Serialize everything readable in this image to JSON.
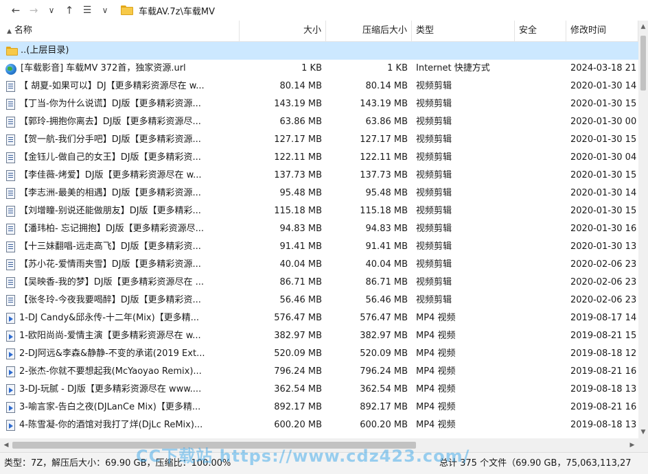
{
  "address_bar": {
    "path": "车载AV.7z\\车载MV"
  },
  "columns": {
    "name": "名称",
    "size": "大小",
    "compressed": "压缩后大小",
    "type": "类型",
    "security": "安全",
    "modified": "修改时间"
  },
  "parent_row": {
    "name": "..(上层目录)"
  },
  "rows": [
    {
      "icon": "globe-icon",
      "name": "[车载影音] 车载MV 372首，独家资源.url",
      "size": "1 KB",
      "compressed": "1 KB",
      "type": "Internet 快捷方式",
      "date": "2024-03-18 21"
    },
    {
      "icon": "video-file-icon",
      "name": "【 胡夏-如果可以】DJ【更多精彩资源尽在 w...",
      "size": "80.14 MB",
      "compressed": "80.14 MB",
      "type": "视频剪辑",
      "date": "2020-01-30 14"
    },
    {
      "icon": "video-file-icon",
      "name": "【丁当-你为什么说谎】DJ版【更多精彩资源...",
      "size": "143.19 MB",
      "compressed": "143.19 MB",
      "type": "视频剪辑",
      "date": "2020-01-30 15"
    },
    {
      "icon": "video-file-icon",
      "name": "【郭玲-拥抱你离去】DJ版【更多精彩资源尽...",
      "size": "63.86 MB",
      "compressed": "63.86 MB",
      "type": "视频剪辑",
      "date": "2020-01-30 00"
    },
    {
      "icon": "video-file-icon",
      "name": "【贺一航-我们分手吧】DJ版【更多精彩资源...",
      "size": "127.17 MB",
      "compressed": "127.17 MB",
      "type": "视频剪辑",
      "date": "2020-01-30 15"
    },
    {
      "icon": "video-file-icon",
      "name": "【金钰儿-做自己的女王】DJ版【更多精彩资...",
      "size": "122.11 MB",
      "compressed": "122.11 MB",
      "type": "视频剪辑",
      "date": "2020-01-30 04"
    },
    {
      "icon": "video-file-icon",
      "name": "【李佳薇-烤爱】DJ版【更多精彩资源尽在 w...",
      "size": "137.73 MB",
      "compressed": "137.73 MB",
      "type": "视频剪辑",
      "date": "2020-01-30 15"
    },
    {
      "icon": "video-file-icon",
      "name": "【李志洲-最美的相遇】DJ版【更多精彩资源...",
      "size": "95.48 MB",
      "compressed": "95.48 MB",
      "type": "视频剪辑",
      "date": "2020-01-30 14"
    },
    {
      "icon": "video-file-icon",
      "name": "【刘增瞳-别说还能做朋友】DJ版【更多精彩...",
      "size": "115.18 MB",
      "compressed": "115.18 MB",
      "type": "视频剪辑",
      "date": "2020-01-30 15"
    },
    {
      "icon": "video-file-icon",
      "name": "【潘玮柏- 忘记拥抱】DJ版【更多精彩资源尽...",
      "size": "94.83 MB",
      "compressed": "94.83 MB",
      "type": "视频剪辑",
      "date": "2020-01-30 16"
    },
    {
      "icon": "video-file-icon",
      "name": "【十三妹翻唱-远走高飞】DJ版【更多精彩资...",
      "size": "91.41 MB",
      "compressed": "91.41 MB",
      "type": "视频剪辑",
      "date": "2020-01-30 13"
    },
    {
      "icon": "video-file-icon",
      "name": "【苏小花-爱情雨夹雪】DJ版【更多精彩资源...",
      "size": "40.04 MB",
      "compressed": "40.04 MB",
      "type": "视频剪辑",
      "date": "2020-02-06 23"
    },
    {
      "icon": "video-file-icon",
      "name": "【吴映香-我的梦】DJ版【更多精彩资源尽在 ...",
      "size": "86.71 MB",
      "compressed": "86.71 MB",
      "type": "视频剪辑",
      "date": "2020-02-06 23"
    },
    {
      "icon": "video-file-icon",
      "name": "【张冬玲-今夜我要喝醉】DJ版【更多精彩资...",
      "size": "56.46 MB",
      "compressed": "56.46 MB",
      "type": "视频剪辑",
      "date": "2020-02-06 23"
    },
    {
      "icon": "mp4-file-icon",
      "name": "1-DJ Candy&邱永传-十二年(Mix)【更多精...",
      "size": "576.47 MB",
      "compressed": "576.47 MB",
      "type": "MP4 视频",
      "date": "2019-08-17 14"
    },
    {
      "icon": "mp4-file-icon",
      "name": "1-欧阳尚尚-爱情主演【更多精彩资源尽在 w...",
      "size": "382.97 MB",
      "compressed": "382.97 MB",
      "type": "MP4 视频",
      "date": "2019-08-21 15"
    },
    {
      "icon": "mp4-file-icon",
      "name": "2-DJ阿远&李森&静静-不变的承诺(2019 Ext...",
      "size": "520.09 MB",
      "compressed": "520.09 MB",
      "type": "MP4 视频",
      "date": "2019-08-18 12"
    },
    {
      "icon": "mp4-file-icon",
      "name": "2-张杰-你就不要想起我(McYaoyao Remix)...",
      "size": "796.24 MB",
      "compressed": "796.24 MB",
      "type": "MP4 视频",
      "date": "2019-08-21 16"
    },
    {
      "icon": "mp4-file-icon",
      "name": "3-DJ-玩腻 - DJ版【更多精彩资源尽在 www....",
      "size": "362.54 MB",
      "compressed": "362.54 MB",
      "type": "MP4 视频",
      "date": "2019-08-18 13"
    },
    {
      "icon": "mp4-file-icon",
      "name": "3-喻言家-告白之夜(DJLanCe Mix)【更多精...",
      "size": "892.17 MB",
      "compressed": "892.17 MB",
      "type": "MP4 视频",
      "date": "2019-08-21 16"
    },
    {
      "icon": "mp4-file-icon",
      "name": "4-陈雪凝-你的酒馆对我打了烊(DjLc ReMix)...",
      "size": "600.20 MB",
      "compressed": "600.20 MB",
      "type": "MP4 视频",
      "date": "2019-08-18 13"
    }
  ],
  "status": {
    "left": "类型：7Z，解压后大小：69.90 GB，压缩比：100.00%",
    "right": "总计 375 个文件（69.90 GB，75,063,113,27"
  },
  "watermark": "CC下载站 https://www.cdz423.com/",
  "colors": {
    "selected_row": "#cce8ff",
    "folder": "#f7c948"
  }
}
